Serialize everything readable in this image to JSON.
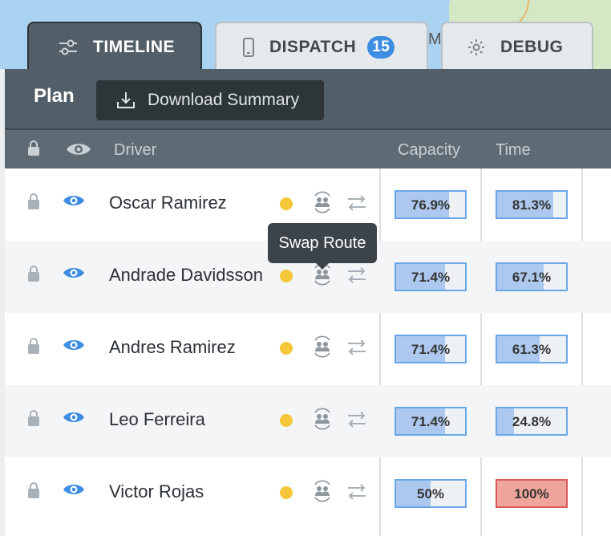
{
  "map": {
    "label": "M"
  },
  "tabs": [
    {
      "label": "TIMELINE",
      "icon": "sliders-icon"
    },
    {
      "label": "DISPATCH",
      "icon": "phone-icon",
      "badge": "15"
    },
    {
      "label": "DEBUG",
      "icon": "gear-icon"
    }
  ],
  "plan": {
    "title": "Plan",
    "download_label": "Download Summary"
  },
  "columns": {
    "driver": "Driver",
    "capacity": "Capacity",
    "time": "Time"
  },
  "tooltip": "Swap Route",
  "rows": [
    {
      "driver": "Oscar Ramirez",
      "capacity": "76.9%",
      "capacity_value": 76.9,
      "time": "81.3%",
      "time_value": 81.3
    },
    {
      "driver": "Andrade Davidsson",
      "capacity": "71.4%",
      "capacity_value": 71.4,
      "time": "67.1%",
      "time_value": 67.1
    },
    {
      "driver": "Andres Ramirez",
      "capacity": "71.4%",
      "capacity_value": 71.4,
      "time": "61.3%",
      "time_value": 61.3
    },
    {
      "driver": "Leo Ferreira",
      "capacity": "71.4%",
      "capacity_value": 71.4,
      "time": "24.8%",
      "time_value": 24.8
    },
    {
      "driver": "Victor Rojas",
      "capacity": "50%",
      "capacity_value": 50,
      "time": "100%",
      "time_value": 100
    }
  ],
  "colors": {
    "accent": "#3d8de3",
    "status_dot": "#f5c63a",
    "bar_fill": "#adc8ee",
    "over_capacity": "#f0a59c"
  }
}
